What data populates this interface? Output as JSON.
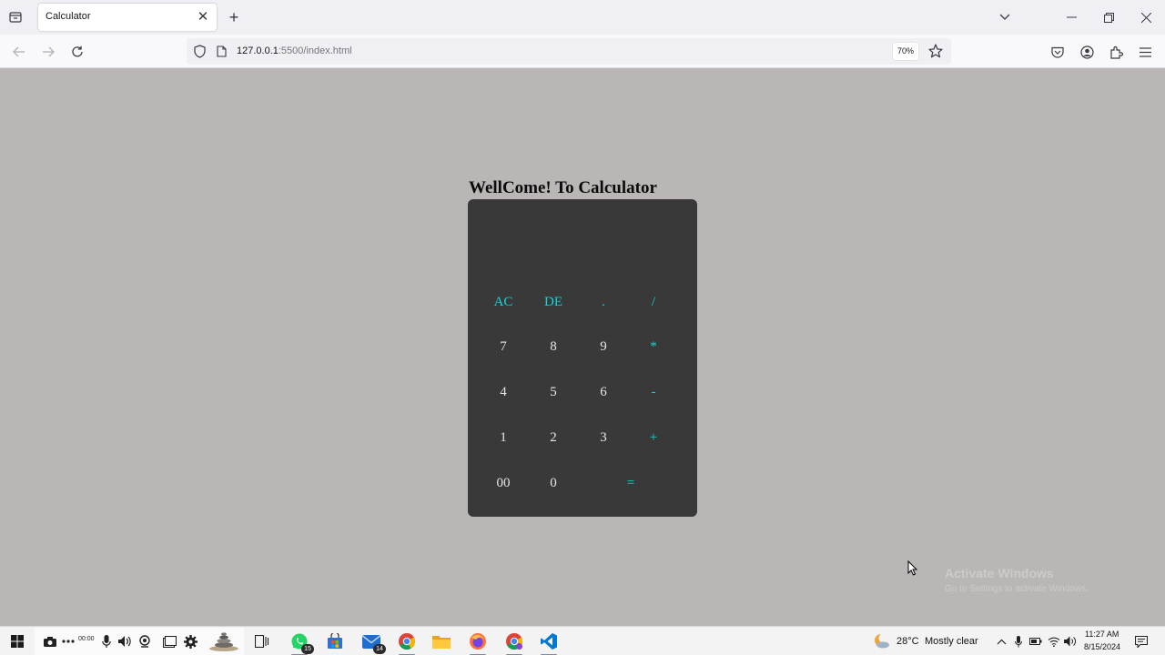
{
  "browser": {
    "tab_title": "Calculator",
    "url_host": "127.0.0.1",
    "url_path": ":5500/index.html",
    "zoom": "70%"
  },
  "page": {
    "title": "WellCome! To Calculator",
    "display_value": "",
    "keys": {
      "ac": "AC",
      "de": "DE",
      "dot": ".",
      "divide": "/",
      "seven": "7",
      "eight": "8",
      "nine": "9",
      "multiply": "*",
      "four": "4",
      "five": "5",
      "six": "6",
      "minus": "-",
      "one": "1",
      "two": "2",
      "three": "3",
      "plus": "+",
      "double_zero": "00",
      "zero": "0",
      "equals": "="
    },
    "watermark": {
      "line1": "Activate Windows",
      "line2": "Go to Settings to activate Windows."
    }
  },
  "taskbar": {
    "meeting_timer": "00:00",
    "whatsapp_badge": "15",
    "mail_badge": "14",
    "weather_temp": "28°C",
    "weather_desc": "Mostly clear",
    "clock_time": "11:27 AM",
    "clock_date": "8/15/2024"
  },
  "colors": {
    "page_background": "#bab6b5",
    "calculator_body": "#393939",
    "operator_key": "#10d6d6",
    "number_key": "#e7e7e7"
  }
}
